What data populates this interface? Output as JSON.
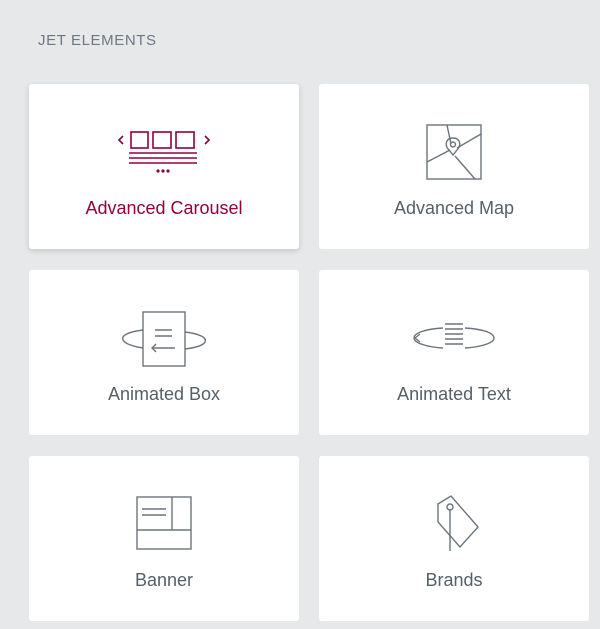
{
  "section": {
    "title": "JET ELEMENTS"
  },
  "widgets": [
    {
      "label": "Advanced Carousel",
      "icon": "advanced-carousel-icon",
      "active": true
    },
    {
      "label": "Advanced Map",
      "icon": "advanced-map-icon",
      "active": false
    },
    {
      "label": "Animated Box",
      "icon": "animated-box-icon",
      "active": false
    },
    {
      "label": "Animated Text",
      "icon": "animated-text-icon",
      "active": false
    },
    {
      "label": "Banner",
      "icon": "banner-icon",
      "active": false
    },
    {
      "label": "Brands",
      "icon": "brands-icon",
      "active": false
    }
  ],
  "colors": {
    "background": "#e6e8ea",
    "card": "#ffffff",
    "text": "#556068",
    "title": "#6d7882",
    "active_accent": "#93003c",
    "icon_stroke": "#6b747c"
  }
}
